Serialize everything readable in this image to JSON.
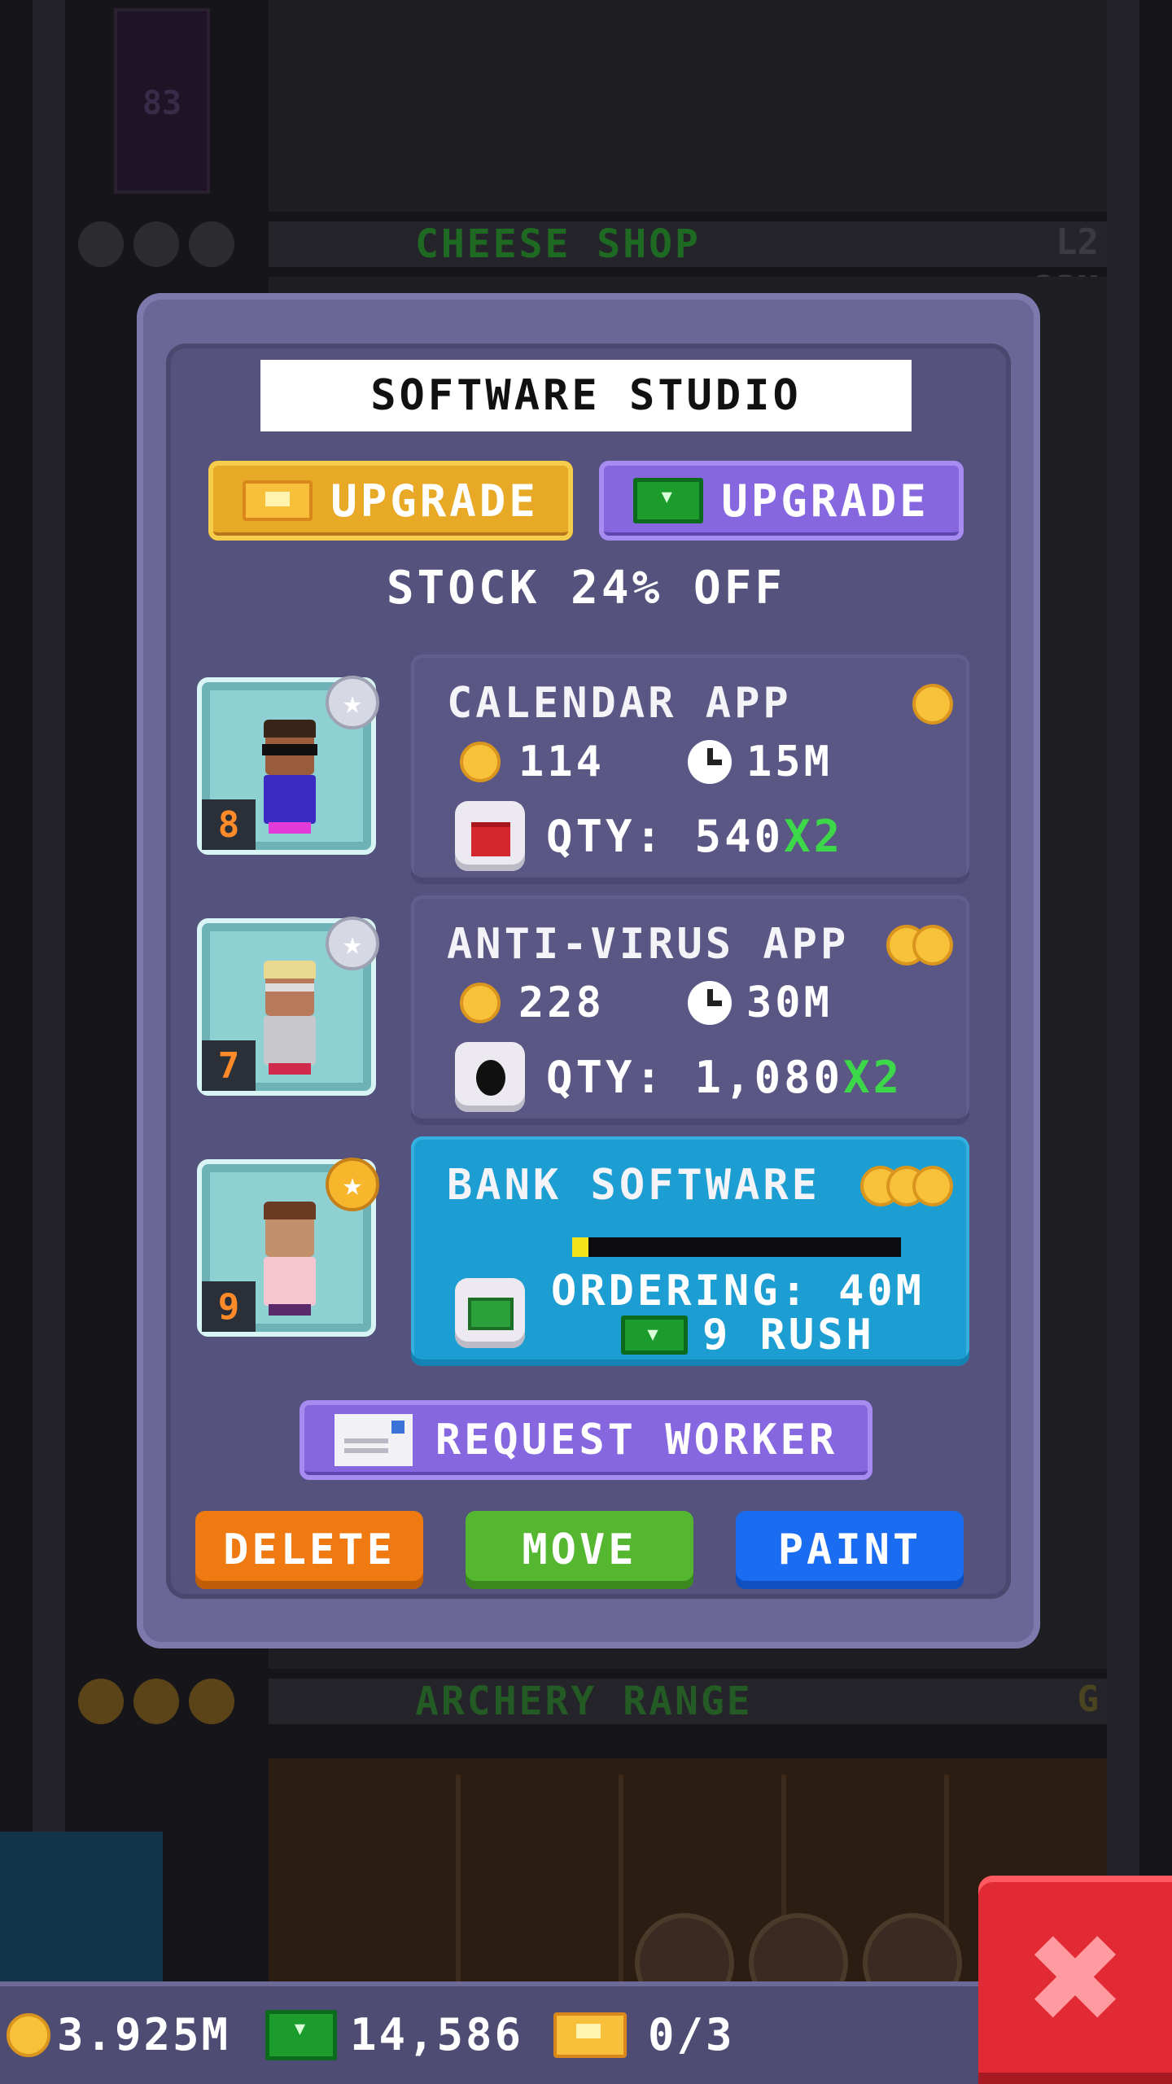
{
  "background": {
    "floors": [
      {
        "name": "CHEESE SHOP",
        "level_tag": "L2",
        "sub_tag": "23M",
        "status_color": "#1f8a25"
      },
      {
        "name": "ARCHERY RANGE",
        "level_tag": "G",
        "status_color": "#1f8a25"
      }
    ],
    "door_number": "83"
  },
  "dialog": {
    "title": "SOFTWARE STUDIO",
    "upgrade_ticket_label": "UPGRADE",
    "upgrade_cash_label": "UPGRADE",
    "stock_discount": "STOCK 24% OFF",
    "workers": [
      {
        "level": "8",
        "star": "silver"
      },
      {
        "level": "7",
        "star": "silver"
      },
      {
        "level": "9",
        "star": "gold"
      }
    ],
    "products": [
      {
        "name": "CALENDAR APP",
        "cost": "114",
        "time": "15M",
        "qty_label": "QTY: 540",
        "multiplier": "X2",
        "tier": 1
      },
      {
        "name": "ANTI-VIRUS APP",
        "cost": "228",
        "time": "30M",
        "qty_label": "QTY: 1,080",
        "multiplier": "X2",
        "tier": 2
      },
      {
        "name": "BANK SOFTWARE",
        "ordering": "ORDERING: 40M",
        "rush": "9 RUSH",
        "progress": 0.05,
        "tier": 3
      }
    ],
    "request_worker_label": "REQUEST WORKER",
    "delete_label": "DELETE",
    "move_label": "MOVE",
    "paint_label": "PAINT"
  },
  "status": {
    "coins": "3.925M",
    "bux": "14,586",
    "tickets": "0/3"
  },
  "colors": {
    "panel": "#6a6797",
    "active_card": "#1d9ed2",
    "coin": "#f7c23a",
    "multiplier": "#3cd84a",
    "close": "#e12a33"
  },
  "icons": {
    "close": "close-icon",
    "coin": "coin-icon",
    "clock": "clock-icon",
    "bux": "bux-icon",
    "ticket": "ticket-icon"
  }
}
